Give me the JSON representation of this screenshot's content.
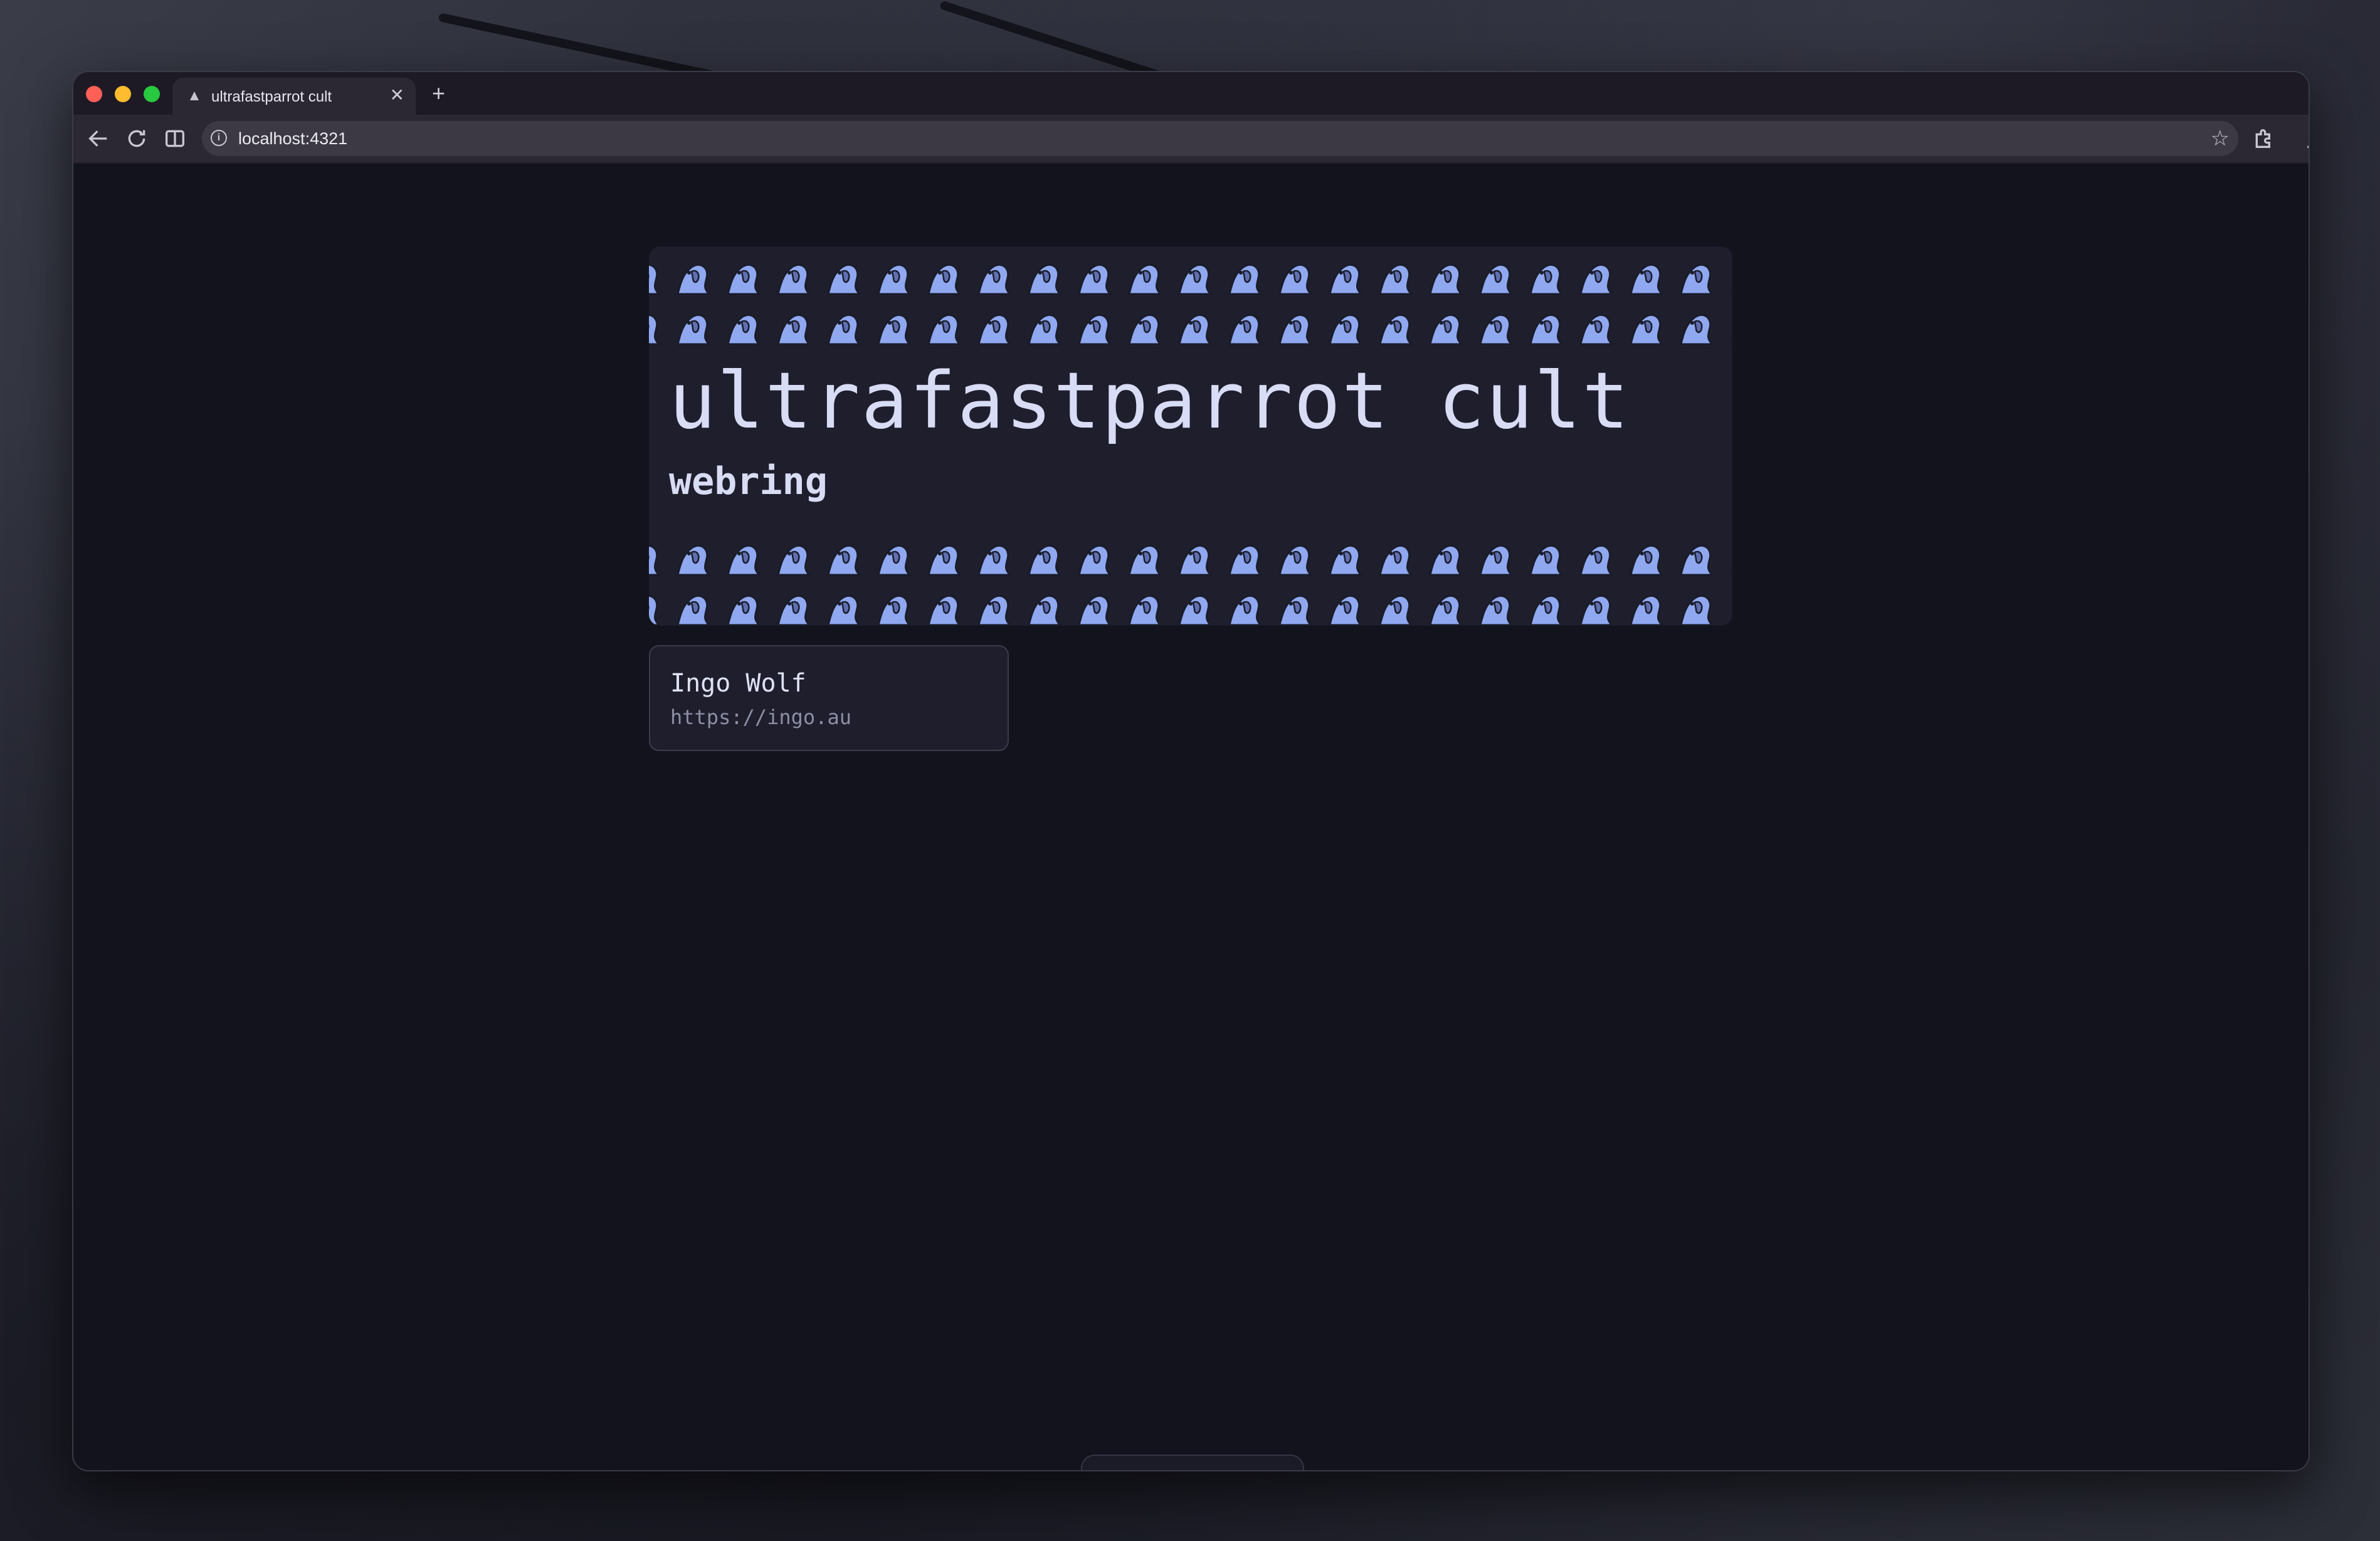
{
  "browser": {
    "tab_title": "ultrafastparrot cult",
    "new_tab_symbol": "+",
    "address": "localhost:4321",
    "traffic_light_colors": [
      "#ff5f57",
      "#febc2e",
      "#28c840"
    ],
    "icons": {
      "back": "arrow-left-icon",
      "reload": "reload-icon",
      "sidepanel": "reading-mode-icon",
      "info": "site-info-icon",
      "bookmark": "star-icon",
      "extensions": "puzzle-icon",
      "downloads": "download-icon",
      "menu": "kebab-menu-icon"
    }
  },
  "page": {
    "hero": {
      "title": "ultrafastparrot cult",
      "subtitle": "webring",
      "decoration": "parrot-icon",
      "parrot_color": "#8fa8f0"
    },
    "members": [
      {
        "name": "Ingo Wolf",
        "url": "https://ingo.au"
      }
    ]
  }
}
